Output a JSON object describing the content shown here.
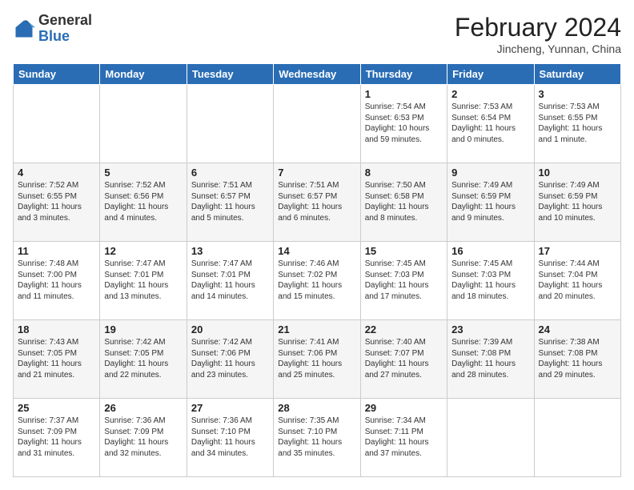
{
  "header": {
    "logo_general": "General",
    "logo_blue": "Blue",
    "month_title": "February 2024",
    "location": "Jincheng, Yunnan, China"
  },
  "days_of_week": [
    "Sunday",
    "Monday",
    "Tuesday",
    "Wednesday",
    "Thursday",
    "Friday",
    "Saturday"
  ],
  "weeks": [
    [
      {
        "day": "",
        "info": ""
      },
      {
        "day": "",
        "info": ""
      },
      {
        "day": "",
        "info": ""
      },
      {
        "day": "",
        "info": ""
      },
      {
        "day": "1",
        "info": "Sunrise: 7:54 AM\nSunset: 6:53 PM\nDaylight: 10 hours and 59 minutes."
      },
      {
        "day": "2",
        "info": "Sunrise: 7:53 AM\nSunset: 6:54 PM\nDaylight: 11 hours and 0 minutes."
      },
      {
        "day": "3",
        "info": "Sunrise: 7:53 AM\nSunset: 6:55 PM\nDaylight: 11 hours and 1 minute."
      }
    ],
    [
      {
        "day": "4",
        "info": "Sunrise: 7:52 AM\nSunset: 6:55 PM\nDaylight: 11 hours and 3 minutes."
      },
      {
        "day": "5",
        "info": "Sunrise: 7:52 AM\nSunset: 6:56 PM\nDaylight: 11 hours and 4 minutes."
      },
      {
        "day": "6",
        "info": "Sunrise: 7:51 AM\nSunset: 6:57 PM\nDaylight: 11 hours and 5 minutes."
      },
      {
        "day": "7",
        "info": "Sunrise: 7:51 AM\nSunset: 6:57 PM\nDaylight: 11 hours and 6 minutes."
      },
      {
        "day": "8",
        "info": "Sunrise: 7:50 AM\nSunset: 6:58 PM\nDaylight: 11 hours and 8 minutes."
      },
      {
        "day": "9",
        "info": "Sunrise: 7:49 AM\nSunset: 6:59 PM\nDaylight: 11 hours and 9 minutes."
      },
      {
        "day": "10",
        "info": "Sunrise: 7:49 AM\nSunset: 6:59 PM\nDaylight: 11 hours and 10 minutes."
      }
    ],
    [
      {
        "day": "11",
        "info": "Sunrise: 7:48 AM\nSunset: 7:00 PM\nDaylight: 11 hours and 11 minutes."
      },
      {
        "day": "12",
        "info": "Sunrise: 7:47 AM\nSunset: 7:01 PM\nDaylight: 11 hours and 13 minutes."
      },
      {
        "day": "13",
        "info": "Sunrise: 7:47 AM\nSunset: 7:01 PM\nDaylight: 11 hours and 14 minutes."
      },
      {
        "day": "14",
        "info": "Sunrise: 7:46 AM\nSunset: 7:02 PM\nDaylight: 11 hours and 15 minutes."
      },
      {
        "day": "15",
        "info": "Sunrise: 7:45 AM\nSunset: 7:03 PM\nDaylight: 11 hours and 17 minutes."
      },
      {
        "day": "16",
        "info": "Sunrise: 7:45 AM\nSunset: 7:03 PM\nDaylight: 11 hours and 18 minutes."
      },
      {
        "day": "17",
        "info": "Sunrise: 7:44 AM\nSunset: 7:04 PM\nDaylight: 11 hours and 20 minutes."
      }
    ],
    [
      {
        "day": "18",
        "info": "Sunrise: 7:43 AM\nSunset: 7:05 PM\nDaylight: 11 hours and 21 minutes."
      },
      {
        "day": "19",
        "info": "Sunrise: 7:42 AM\nSunset: 7:05 PM\nDaylight: 11 hours and 22 minutes."
      },
      {
        "day": "20",
        "info": "Sunrise: 7:42 AM\nSunset: 7:06 PM\nDaylight: 11 hours and 23 minutes."
      },
      {
        "day": "21",
        "info": "Sunrise: 7:41 AM\nSunset: 7:06 PM\nDaylight: 11 hours and 25 minutes."
      },
      {
        "day": "22",
        "info": "Sunrise: 7:40 AM\nSunset: 7:07 PM\nDaylight: 11 hours and 27 minutes."
      },
      {
        "day": "23",
        "info": "Sunrise: 7:39 AM\nSunset: 7:08 PM\nDaylight: 11 hours and 28 minutes."
      },
      {
        "day": "24",
        "info": "Sunrise: 7:38 AM\nSunset: 7:08 PM\nDaylight: 11 hours and 29 minutes."
      }
    ],
    [
      {
        "day": "25",
        "info": "Sunrise: 7:37 AM\nSunset: 7:09 PM\nDaylight: 11 hours and 31 minutes."
      },
      {
        "day": "26",
        "info": "Sunrise: 7:36 AM\nSunset: 7:09 PM\nDaylight: 11 hours and 32 minutes."
      },
      {
        "day": "27",
        "info": "Sunrise: 7:36 AM\nSunset: 7:10 PM\nDaylight: 11 hours and 34 minutes."
      },
      {
        "day": "28",
        "info": "Sunrise: 7:35 AM\nSunset: 7:10 PM\nDaylight: 11 hours and 35 minutes."
      },
      {
        "day": "29",
        "info": "Sunrise: 7:34 AM\nSunset: 7:11 PM\nDaylight: 11 hours and 37 minutes."
      },
      {
        "day": "",
        "info": ""
      },
      {
        "day": "",
        "info": ""
      }
    ]
  ]
}
